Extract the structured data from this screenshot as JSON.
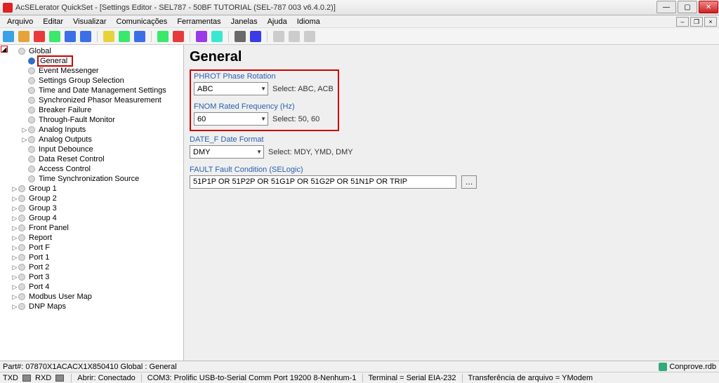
{
  "window": {
    "title": "AcSELerator QuickSet - [Settings Editor - SEL787 - 50BF TUTORIAL (SEL-787 003 v6.4.0.2)]"
  },
  "menu": [
    "Arquivo",
    "Editar",
    "Visualizar",
    "Comunicações",
    "Ferramentas",
    "Janelas",
    "Ajuda",
    "Idioma"
  ],
  "toolbar_colors": [
    "#3aa0e8",
    "#e8a23a",
    "#e83a3a",
    "#3ae86b",
    "#3a6fe8",
    "#3a6fe8",
    "#e8d23a",
    "#3ae86b",
    "#3a6fe8",
    "#3ae86b",
    "#e83a3a",
    "#9a3ae8",
    "#3ae8d2",
    "#6a6a6a",
    "#3a3ae8",
    "#cccccc",
    "#cccccc",
    "#cccccc"
  ],
  "tree": {
    "root": "Global",
    "root_children": [
      {
        "label": "General",
        "selected": true
      },
      {
        "label": "Event Messenger"
      },
      {
        "label": "Settings Group Selection"
      },
      {
        "label": "Time and Date Management Settings"
      },
      {
        "label": "Synchronized Phasor Measurement"
      },
      {
        "label": "Breaker Failure"
      },
      {
        "label": "Through-Fault Monitor"
      },
      {
        "label": "Analog Inputs",
        "exp": true
      },
      {
        "label": "Analog Outputs",
        "exp": true
      },
      {
        "label": "Input Debounce"
      },
      {
        "label": "Data Reset Control"
      },
      {
        "label": "Access Control"
      },
      {
        "label": "Time Synchronization Source"
      }
    ],
    "siblings": [
      {
        "label": "Group 1",
        "exp": true
      },
      {
        "label": "Group 2",
        "exp": true
      },
      {
        "label": "Group 3",
        "exp": true
      },
      {
        "label": "Group 4",
        "exp": true
      },
      {
        "label": "Front Panel",
        "exp": true
      },
      {
        "label": "Report",
        "exp": true
      },
      {
        "label": "Port F",
        "exp": true
      },
      {
        "label": "Port 1",
        "exp": true
      },
      {
        "label": "Port 2",
        "exp": true
      },
      {
        "label": "Port 3",
        "exp": true
      },
      {
        "label": "Port 4",
        "exp": true
      },
      {
        "label": "Modbus User Map",
        "exp": true
      },
      {
        "label": "DNP Maps",
        "exp": true
      }
    ]
  },
  "content": {
    "heading": "General",
    "phrot": {
      "label": "PHROT Phase Rotation",
      "value": "ABC",
      "hint": "Select: ABC, ACB"
    },
    "fnom": {
      "label": "FNOM Rated Frequency (Hz)",
      "value": "60",
      "hint": "Select: 50, 60"
    },
    "datef": {
      "label": "DATE_F Date Format",
      "value": "DMY",
      "hint": "Select: MDY, YMD, DMY"
    },
    "fault": {
      "label": "FAULT Fault Condition (SELogic)",
      "value": "51P1P OR 51P2P OR 51G1P OR 51G2P OR 51N1P OR TRIP"
    }
  },
  "status1": {
    "left": "Part#: 07870X1ACACX1X850410   Global : General",
    "right_logo": "Conprove.rdb"
  },
  "status2": {
    "txd": "TXD",
    "rxd": "RXD",
    "open": "Abrir: Conectado",
    "com": "COM3: Prolific USB-to-Serial Comm Port  19200  8-Nenhum-1",
    "term": "Terminal = Serial EIA-232",
    "xfer": "Transferência de arquivo = YModem"
  }
}
